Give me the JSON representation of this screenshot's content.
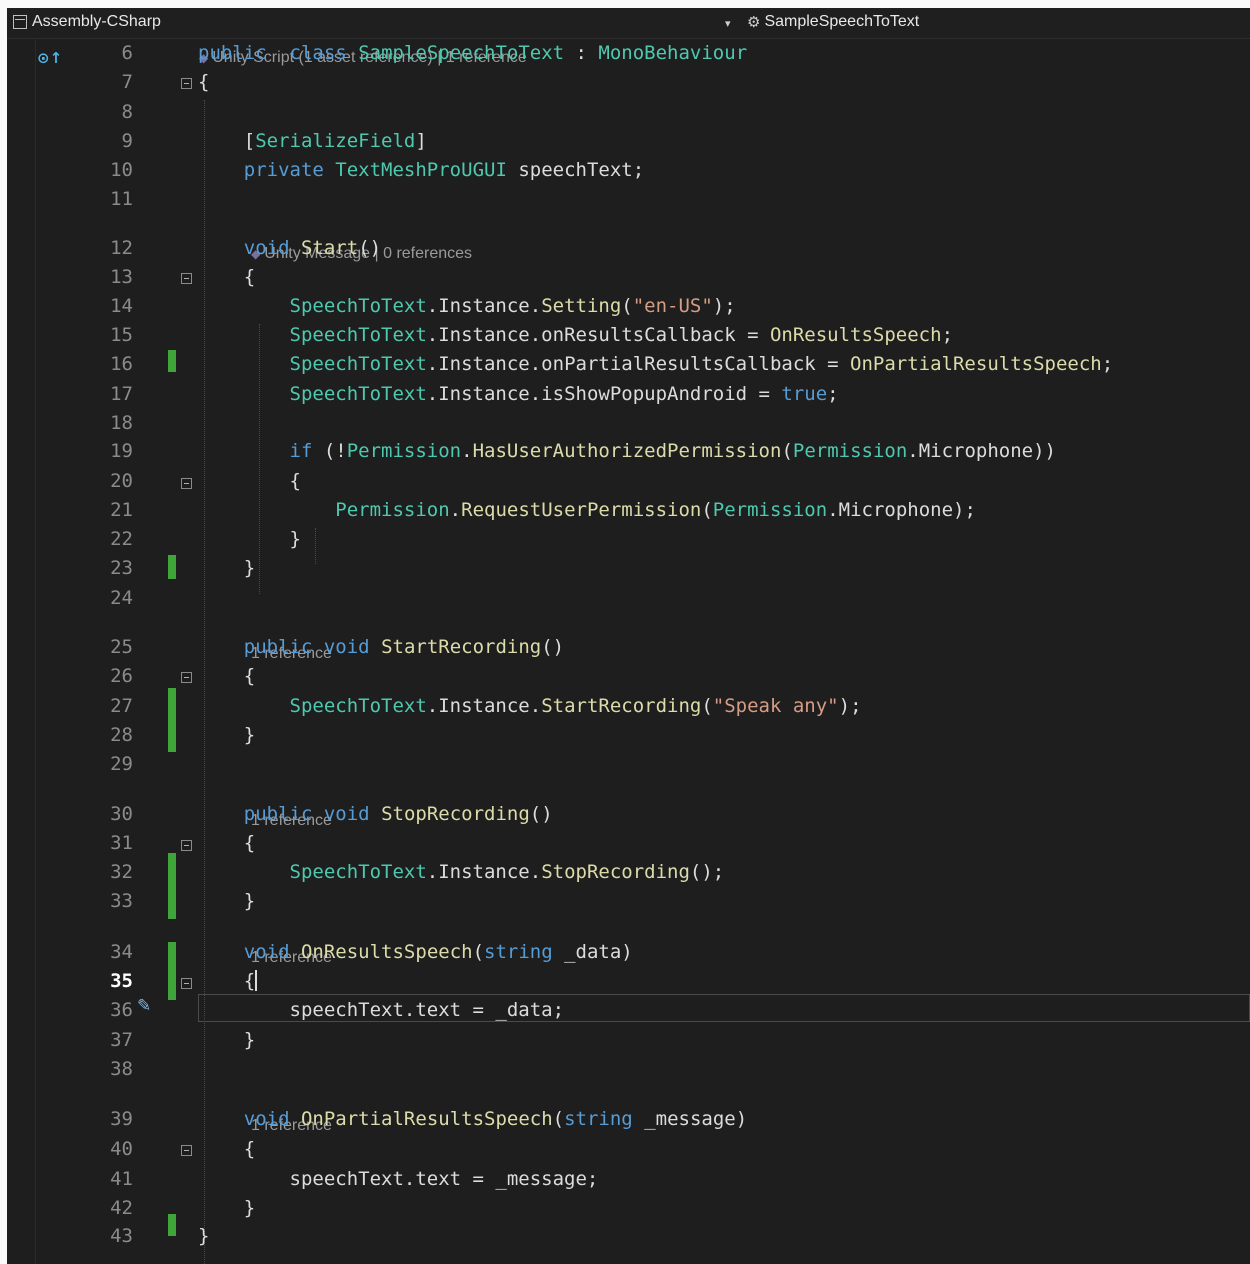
{
  "toolbar": {
    "project": "Assembly-CSharp",
    "class_name": "SampleSpeechToText",
    "dropdown_glyph": "▾"
  },
  "icons": {
    "project": "project-icon",
    "class": "class-icon",
    "override": "override-marker-icon",
    "edit": "quick-action-icon",
    "lens_dot": "unity-icon"
  },
  "colors": {
    "keyword": "#569cd6",
    "type": "#4ec9b0",
    "method": "#dcdcaa",
    "string": "#d69d85",
    "change_bar": "#3fa53a"
  },
  "lenses": {
    "class": "Unity Script (1 asset reference) | 1 reference",
    "start": "Unity Message | 0 references",
    "start_recording": "1 reference",
    "stop_recording": "1 reference",
    "on_results": "1 reference",
    "on_partial": "1 reference"
  },
  "lines": [
    {
      "n": "6",
      "t": [
        [
          "k",
          "public"
        ],
        [
          "",
          "  "
        ],
        [
          "k",
          "class"
        ],
        [
          "",
          " "
        ],
        [
          "t",
          "SampleSpeechToText"
        ],
        [
          "",
          " : "
        ],
        [
          "t",
          "MonoBehaviour"
        ]
      ]
    },
    {
      "n": "7",
      "t": [
        [
          "",
          "{"
        ]
      ]
    },
    {
      "n": "8",
      "t": []
    },
    {
      "n": "9",
      "t": [
        [
          "",
          "    ["
        ],
        [
          "t",
          "SerializeField"
        ],
        [
          "",
          "]"
        ]
      ]
    },
    {
      "n": "10",
      "t": [
        [
          "",
          "    "
        ],
        [
          "k",
          "private"
        ],
        [
          "",
          " "
        ],
        [
          "t",
          "TextMeshProUGUI"
        ],
        [
          "",
          " speechText;"
        ]
      ]
    },
    {
      "n": "11",
      "t": []
    },
    {
      "n": "12",
      "t": [
        [
          "",
          "    "
        ],
        [
          "k",
          "void"
        ],
        [
          "",
          " "
        ],
        [
          "m",
          "Start"
        ],
        [
          "",
          "()"
        ]
      ]
    },
    {
      "n": "13",
      "t": [
        [
          "",
          "    {"
        ]
      ]
    },
    {
      "n": "14",
      "t": [
        [
          "",
          "        "
        ],
        [
          "t",
          "SpeechToText"
        ],
        [
          "",
          ".Instance."
        ],
        [
          "m",
          "Setting"
        ],
        [
          "",
          "("
        ],
        [
          "s",
          "\"en-US\""
        ],
        [
          "",
          ");"
        ]
      ]
    },
    {
      "n": "15",
      "t": [
        [
          "",
          "        "
        ],
        [
          "t",
          "SpeechToText"
        ],
        [
          "",
          ".Instance.onResultsCallback = "
        ],
        [
          "m",
          "OnResultsSpeech"
        ],
        [
          "",
          ";"
        ]
      ]
    },
    {
      "n": "16",
      "t": [
        [
          "",
          "        "
        ],
        [
          "t",
          "SpeechToText"
        ],
        [
          "",
          ".Instance.onPartialResultsCallback = "
        ],
        [
          "m",
          "OnPartialResultsSpeech"
        ],
        [
          "",
          ";"
        ]
      ]
    },
    {
      "n": "17",
      "t": [
        [
          "",
          "        "
        ],
        [
          "t",
          "SpeechToText"
        ],
        [
          "",
          ".Instance.isShowPopupAndroid = "
        ],
        [
          "k",
          "true"
        ],
        [
          "",
          ";"
        ]
      ]
    },
    {
      "n": "18",
      "t": []
    },
    {
      "n": "19",
      "t": [
        [
          "",
          "        "
        ],
        [
          "k",
          "if"
        ],
        [
          "",
          " (!"
        ],
        [
          "t",
          "Permission"
        ],
        [
          "",
          "."
        ],
        [
          "m",
          "HasUserAuthorizedPermission"
        ],
        [
          "",
          "("
        ],
        [
          "t",
          "Permission"
        ],
        [
          "",
          ".Microphone))"
        ]
      ]
    },
    {
      "n": "20",
      "t": [
        [
          "",
          "        {"
        ]
      ]
    },
    {
      "n": "21",
      "t": [
        [
          "",
          "            "
        ],
        [
          "t",
          "Permission"
        ],
        [
          "",
          "."
        ],
        [
          "m",
          "RequestUserPermission"
        ],
        [
          "",
          "("
        ],
        [
          "t",
          "Permission"
        ],
        [
          "",
          ".Microphone);"
        ]
      ]
    },
    {
      "n": "22",
      "t": [
        [
          "",
          "        }"
        ]
      ]
    },
    {
      "n": "23",
      "t": [
        [
          "",
          "    }"
        ]
      ]
    },
    {
      "n": "24",
      "t": []
    },
    {
      "n": "25",
      "t": [
        [
          "",
          "    "
        ],
        [
          "k",
          "public"
        ],
        [
          "",
          " "
        ],
        [
          "k",
          "void"
        ],
        [
          "",
          " "
        ],
        [
          "m",
          "StartRecording"
        ],
        [
          "",
          "()"
        ]
      ]
    },
    {
      "n": "26",
      "t": [
        [
          "",
          "    {"
        ]
      ]
    },
    {
      "n": "27",
      "t": [
        [
          "",
          "        "
        ],
        [
          "t",
          "SpeechToText"
        ],
        [
          "",
          ".Instance."
        ],
        [
          "m",
          "StartRecording"
        ],
        [
          "",
          "("
        ],
        [
          "s",
          "\"Speak any\""
        ],
        [
          "",
          ");"
        ]
      ]
    },
    {
      "n": "28",
      "t": [
        [
          "",
          "    }"
        ]
      ]
    },
    {
      "n": "29",
      "t": []
    },
    {
      "n": "30",
      "t": [
        [
          "",
          "    "
        ],
        [
          "k",
          "public"
        ],
        [
          "",
          " "
        ],
        [
          "k",
          "void"
        ],
        [
          "",
          " "
        ],
        [
          "m",
          "StopRecording"
        ],
        [
          "",
          "()"
        ]
      ]
    },
    {
      "n": "31",
      "t": [
        [
          "",
          "    {"
        ]
      ]
    },
    {
      "n": "32",
      "t": [
        [
          "",
          "        "
        ],
        [
          "t",
          "SpeechToText"
        ],
        [
          "",
          ".Instance."
        ],
        [
          "m",
          "StopRecording"
        ],
        [
          "",
          "();"
        ]
      ]
    },
    {
      "n": "33",
      "t": [
        [
          "",
          "    }"
        ]
      ]
    },
    {
      "n": "34",
      "t": [
        [
          "",
          "    "
        ],
        [
          "k",
          "void"
        ],
        [
          "",
          " "
        ],
        [
          "m",
          "OnResultsSpeech"
        ],
        [
          "",
          "("
        ],
        [
          "k",
          "string"
        ],
        [
          "",
          " _data)"
        ]
      ]
    },
    {
      "n": "35",
      "t": [
        [
          "",
          "    {"
        ]
      ]
    },
    {
      "n": "36",
      "t": [
        [
          "",
          "        speechText.text = _data;"
        ]
      ]
    },
    {
      "n": "37",
      "t": [
        [
          "",
          "    }"
        ]
      ]
    },
    {
      "n": "38",
      "t": []
    },
    {
      "n": "39",
      "t": [
        [
          "",
          "    "
        ],
        [
          "k",
          "void"
        ],
        [
          "",
          " "
        ],
        [
          "m",
          "OnPartialResultsSpeech"
        ],
        [
          "",
          "("
        ],
        [
          "k",
          "string"
        ],
        [
          "",
          " _message)"
        ]
      ]
    },
    {
      "n": "40",
      "t": [
        [
          "",
          "    {"
        ]
      ]
    },
    {
      "n": "41",
      "t": [
        [
          "",
          "        speechText.text = _message;"
        ]
      ]
    },
    {
      "n": "42",
      "t": [
        [
          "",
          "    }"
        ]
      ]
    },
    {
      "n": "43",
      "t": [
        [
          "",
          "}"
        ]
      ]
    }
  ],
  "active_line": "35"
}
